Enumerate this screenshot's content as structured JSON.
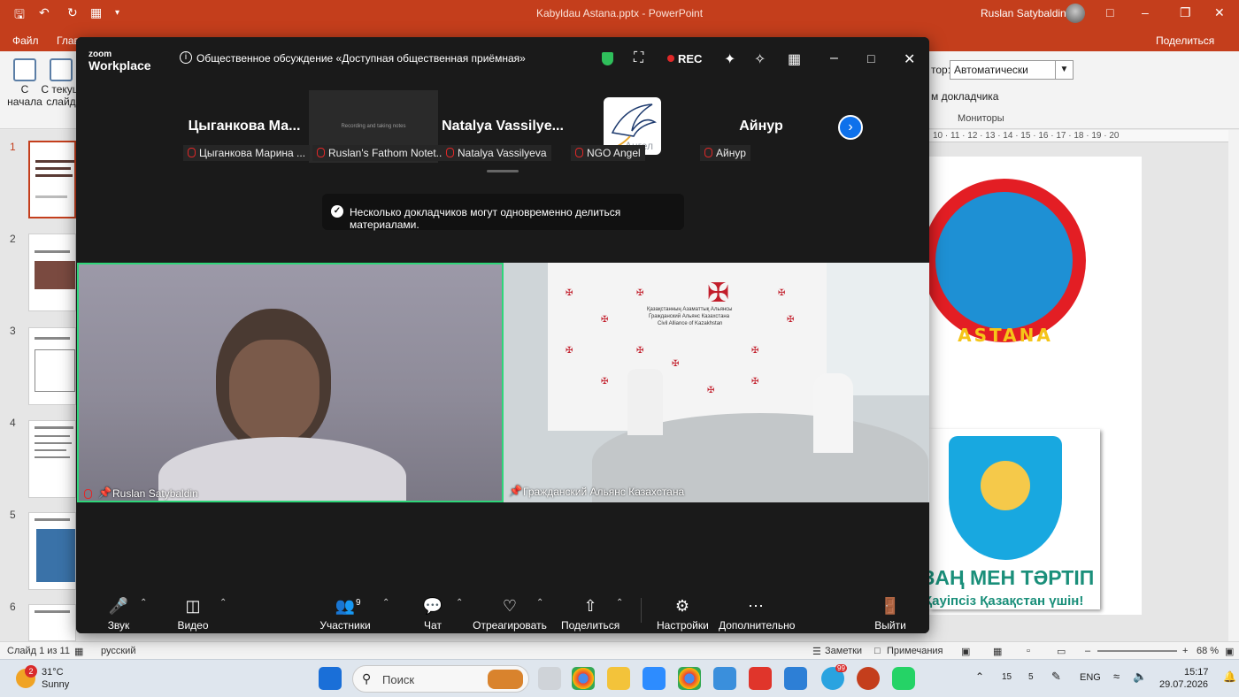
{
  "ppt": {
    "window_title": "Kabyldau Astana.pptx  -  PowerPoint",
    "user": "Ruslan Satybaldin",
    "tabs": [
      "Файл",
      "Глав"
    ],
    "share": "Поделиться",
    "ribbon": {
      "from_start_1": "С",
      "from_start_2": "начала",
      "from_current_1": "С текущ",
      "from_current_2": "слайд",
      "monitor_label": "тор:",
      "monitor_value": "Автоматически",
      "presenter_view": "м докладчика",
      "monitors_group": "Мониторы"
    },
    "thumbnails": [
      "1",
      "2",
      "3",
      "4",
      "5",
      "6"
    ],
    "ruler": "10 · 11 · 12 · 13 · 14 · 15 · 16 · 17 · 18 · 19 · 20",
    "slide": {
      "emblem_text": "ASTANA",
      "title": "ЗАҢ МЕН ТӘРТІП",
      "subtitle": "Қауіпсіз Қазақстан үшін!"
    },
    "status": {
      "slide_of": "Слайд 1 из 11",
      "language": "русский",
      "notes": "Заметки",
      "comments": "Примечания",
      "zoom": "68 %"
    }
  },
  "zoom": {
    "logo_small": "zoom",
    "logo_big": "Workplace",
    "meeting_title": "Общественное обсуждение «Доступная общественная приёмная»",
    "rec": "REC",
    "participants": [
      {
        "display": "Цыганкова  Ма...",
        "tag": "Цыганкова Марина ..."
      },
      {
        "display": "",
        "tag": "Ruslan's Fathom Notet..."
      },
      {
        "display": "Natalya  Vassilye...",
        "tag": "Natalya Vassilyeva"
      },
      {
        "display": "",
        "tag": "NGO Angel"
      },
      {
        "display": "Айнур",
        "tag": "Айнур"
      }
    ],
    "fathom_text": "Recording and taking notes",
    "angel_logo_text": "Ангел",
    "toast": "Несколько докладчиков могут одновременно делиться материалами.",
    "video_left_name": "Ruslan Satybaldin",
    "video_right_name": "Гражданский Альянс Казахстана",
    "banner": {
      "line1": "Қазақстанның Азаматтық Альянсы",
      "line2": "Гражданский Альянс Казахстана",
      "line3": "Civil Alliance of Kazakhstan"
    },
    "toolbar": {
      "audio": "Звук",
      "video": "Видео",
      "participants": "Участники",
      "participants_count": "9",
      "chat": "Чат",
      "react": "Отреагировать",
      "share": "Поделиться",
      "settings": "Настройки",
      "more": "Дополнительно",
      "leave": "Выйти"
    }
  },
  "taskbar": {
    "weather_temp": "31°C",
    "weather_desc": "Sunny",
    "weather_badge": "2",
    "search": "Поиск",
    "tray_1": "15",
    "tray_2": "5",
    "lang": "ENG",
    "telegram_badge": "99",
    "time": "15:17",
    "date": "29.07.2026"
  }
}
